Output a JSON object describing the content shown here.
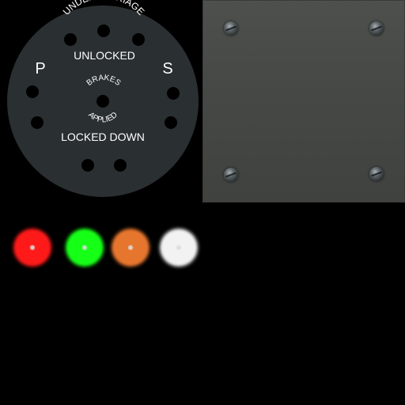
{
  "gauge": {
    "top_arc_label": "UNDERCARRIAGE",
    "status_unlocked": "UNLOCKED",
    "status_locked_down": "LOCKED DOWN",
    "left_label": "P",
    "right_label": "S",
    "brakes_label": "BRAKES",
    "applied_label": "APPLIED",
    "face_color": "#2a2f31"
  },
  "plate": {
    "color": "#464945"
  },
  "lamps": [
    {
      "name": "red",
      "color": "#ff1a1a"
    },
    {
      "name": "green",
      "color": "#16ff16"
    },
    {
      "name": "orange",
      "color": "#e6762e"
    },
    {
      "name": "white",
      "color": "#f2f2f2"
    }
  ]
}
